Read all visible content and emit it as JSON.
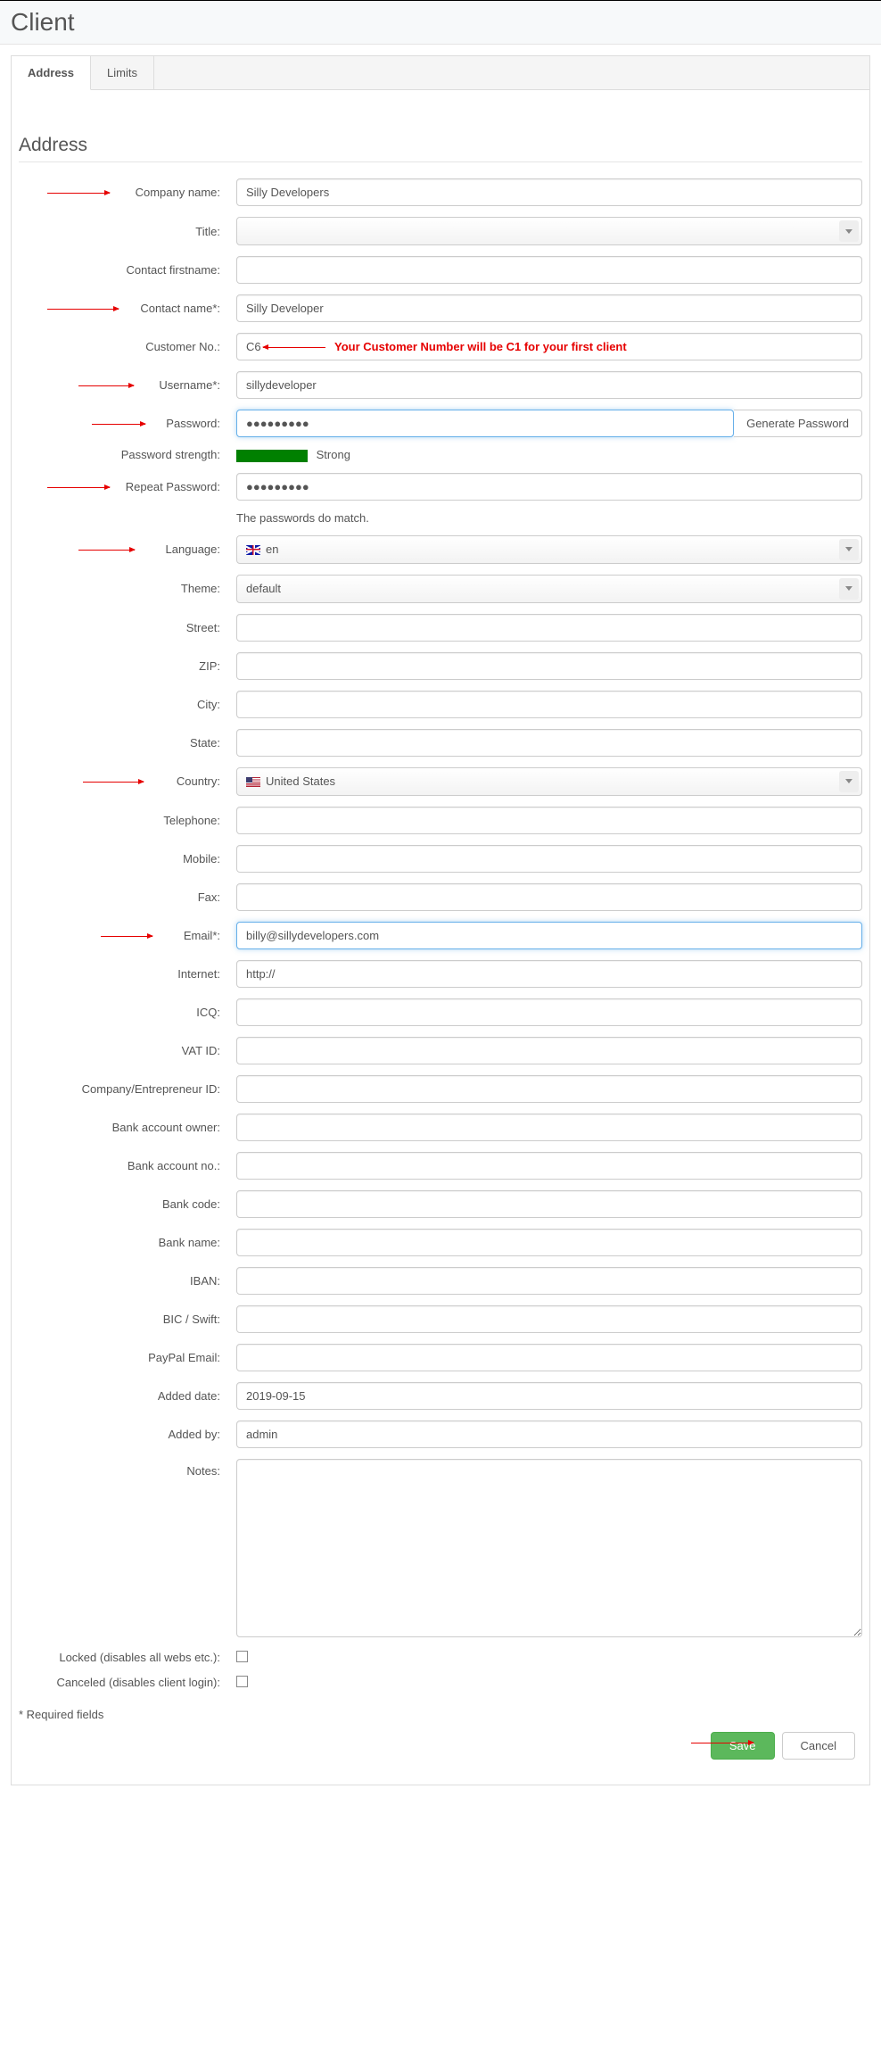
{
  "header": {
    "title": "Client"
  },
  "tabs": {
    "address": "Address",
    "limits": "Limits"
  },
  "section": {
    "title": "Address"
  },
  "labels": {
    "company_name": "Company name:",
    "title": "Title:",
    "contact_firstname": "Contact firstname:",
    "contact_name": "Contact name*:",
    "customer_no": "Customer No.:",
    "username": "Username*:",
    "password": "Password:",
    "password_strength": "Password strength:",
    "repeat_password": "Repeat Password:",
    "language": "Language:",
    "theme": "Theme:",
    "street": "Street:",
    "zip": "ZIP:",
    "city": "City:",
    "state": "State:",
    "country": "Country:",
    "telephone": "Telephone:",
    "mobile": "Mobile:",
    "fax": "Fax:",
    "email": "Email*:",
    "internet": "Internet:",
    "icq": "ICQ:",
    "vat_id": "VAT ID:",
    "company_entrepreneur_id": "Company/Entrepreneur ID:",
    "bank_account_owner": "Bank account owner:",
    "bank_account_no": "Bank account no.:",
    "bank_code": "Bank code:",
    "bank_name": "Bank name:",
    "iban": "IBAN:",
    "bic_swift": "BIC / Swift:",
    "paypal_email": "PayPal Email:",
    "added_date": "Added date:",
    "added_by": "Added by:",
    "notes": "Notes:",
    "locked": "Locked (disables all webs etc.):",
    "canceled": "Canceled (disables client login):"
  },
  "values": {
    "company_name": "Silly Developers",
    "title": "",
    "contact_firstname": "",
    "contact_name": "Silly Developer",
    "customer_no": "C6",
    "username": "sillydeveloper",
    "password": "●●●●●●●●●",
    "repeat_password": "●●●●●●●●●",
    "language": "en",
    "theme": "default",
    "street": "",
    "zip": "",
    "city": "",
    "state": "",
    "country": "United States",
    "telephone": "",
    "mobile": "",
    "fax": "",
    "email": "billy@sillydevelopers.com",
    "internet": "http://",
    "icq": "",
    "vat_id": "",
    "company_entrepreneur_id": "",
    "bank_account_owner": "",
    "bank_account_no": "",
    "bank_code": "",
    "bank_name": "",
    "iban": "",
    "bic_swift": "",
    "paypal_email": "",
    "added_date": "2019-09-15",
    "added_by": "admin",
    "notes": "",
    "locked": false,
    "canceled": false
  },
  "password_strength": "Strong",
  "password_match_text": "The passwords do match.",
  "generate_password_btn": "Generate Password",
  "required_note": "* Required fields",
  "buttons": {
    "save": "Save",
    "cancel": "Cancel"
  },
  "annotations": {
    "customer_no": "Your Customer Number will be C1 for your first client"
  }
}
